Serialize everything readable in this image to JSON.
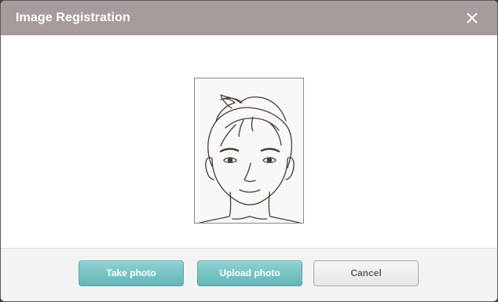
{
  "dialog": {
    "title": "Image Registration",
    "close_icon": "close-icon"
  },
  "photo": {
    "placeholder_icon": "face-portrait-placeholder"
  },
  "footer": {
    "take_photo_label": "Take photo",
    "upload_photo_label": "Upload photo",
    "cancel_label": "Cancel"
  },
  "colors": {
    "titlebar": "#a69c9c",
    "primary_button": "#76c3c4",
    "secondary_button": "#eeeeee"
  }
}
